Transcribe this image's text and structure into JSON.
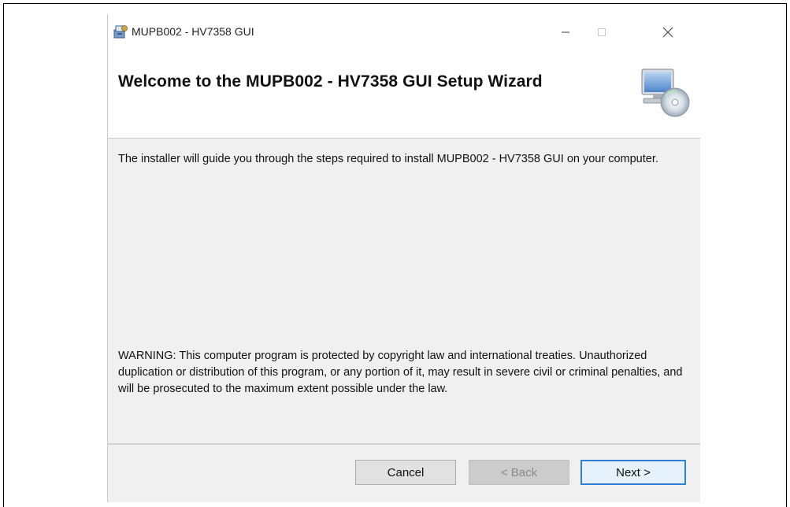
{
  "window": {
    "title": "MUPB002 - HV7358 GUI",
    "controls": {
      "minimize": "minimize-icon",
      "maximize": "maximize-icon",
      "close": "close-icon"
    }
  },
  "header": {
    "title": "Welcome to the MUPB002 - HV7358 GUI Setup Wizard",
    "icon": "setup-computer-icon"
  },
  "content": {
    "intro": "The installer will guide you through the steps required to install MUPB002 - HV7358 GUI on your computer.",
    "warning": "WARNING: This computer program is protected by copyright law and international treaties. Unauthorized duplication or distribution of this program, or any portion of it, may result in severe civil or criminal penalties, and will be prosecuted to the maximum extent possible under the law."
  },
  "buttons": {
    "cancel": "Cancel",
    "back": "< Back",
    "next": "Next >"
  },
  "colors": {
    "accent": "#2f7fd6",
    "body_background": "#f0f0f0"
  }
}
